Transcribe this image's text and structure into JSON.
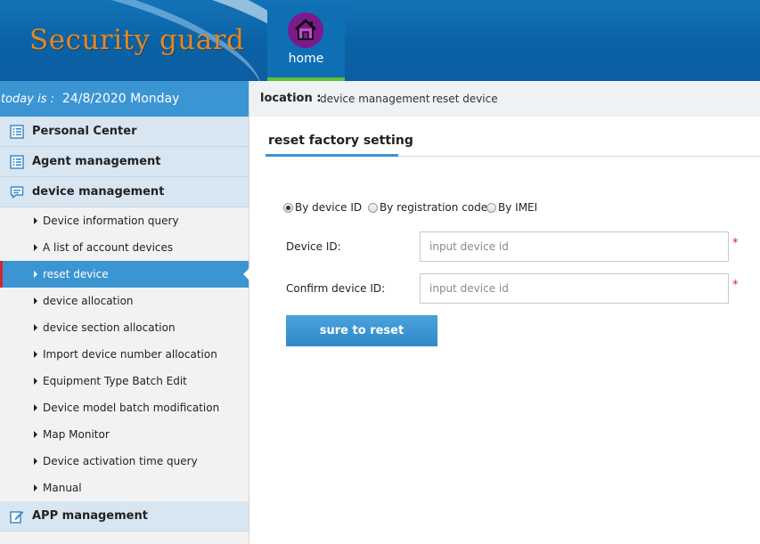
{
  "header": {
    "logo_text": "Security guard",
    "home_label": "home",
    "home_icon": "home-icon",
    "accent_color": "#5fc036"
  },
  "sidebar": {
    "date_label": "today is :",
    "date_value": "24/8/2020 Monday",
    "sections": [
      {
        "label": "Personal Center",
        "icon": "list-icon"
      },
      {
        "label": "Agent management",
        "icon": "list-icon"
      },
      {
        "label": "device management",
        "icon": "chat-icon"
      }
    ],
    "device_items": [
      {
        "label": "Device information query",
        "active": false
      },
      {
        "label": "A list of account devices",
        "active": false
      },
      {
        "label": "reset device",
        "active": true
      },
      {
        "label": "device allocation",
        "active": false
      },
      {
        "label": "device section allocation",
        "active": false
      },
      {
        "label": "Import device number allocation",
        "active": false
      },
      {
        "label": "Equipment Type Batch Edit",
        "active": false
      },
      {
        "label": "Device model batch modification",
        "active": false
      },
      {
        "label": "Map Monitor",
        "active": false
      },
      {
        "label": "Device activation time query",
        "active": false
      },
      {
        "label": "Manual",
        "active": false
      }
    ],
    "app_section": {
      "label": "APP management",
      "icon": "edit-icon"
    }
  },
  "breadcrumb": {
    "label": "location :",
    "items": [
      "device management",
      "reset device"
    ],
    "separator": "›"
  },
  "main": {
    "title": "reset factory setting",
    "radios": [
      {
        "label": "By device ID",
        "checked": true
      },
      {
        "label": "By registration code",
        "checked": false
      },
      {
        "label": "By IMEI",
        "checked": false
      }
    ],
    "fields": [
      {
        "label": "Device ID:",
        "placeholder": "input device id",
        "value": "",
        "required_mark": "*"
      },
      {
        "label": "Confirm device ID:",
        "placeholder": "input device id",
        "value": "",
        "required_mark": "*"
      }
    ],
    "submit_label": "sure to reset"
  },
  "colors": {
    "header_blue": "#0a62a5",
    "active_blue": "#3c95d3",
    "required_red": "#d3242b",
    "logo_orange": "#e7861f"
  }
}
